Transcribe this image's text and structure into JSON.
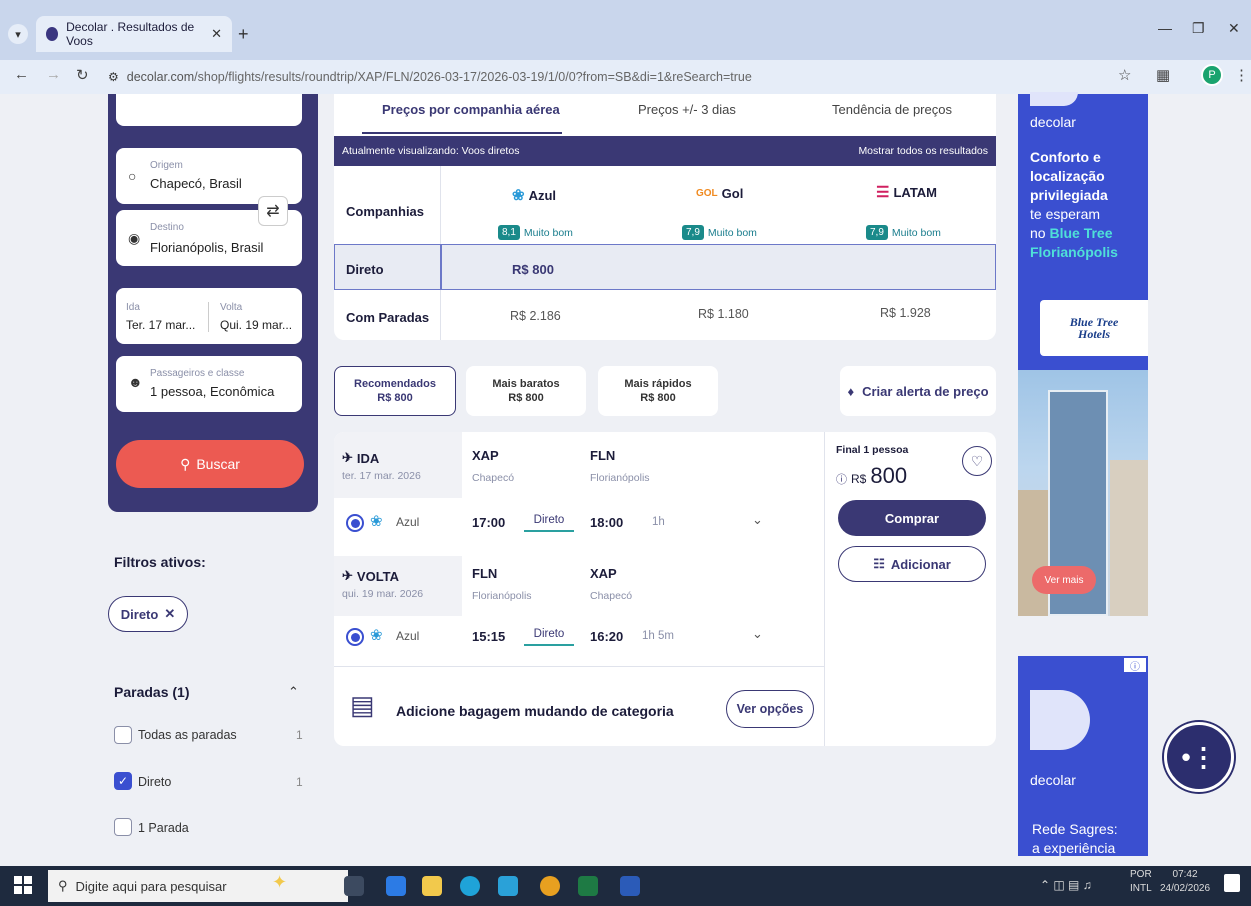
{
  "browser": {
    "tab_title": "Decolar . Resultados de Voos",
    "url_site": "decolar.com",
    "url_path": "/shop/flights/results/roundtrip/XAP/FLN/2026-03-17/2026-03-19/1/0/0?from=SB&di=1&reSearch=true",
    "profile_initial": "P"
  },
  "search": {
    "origin_label": "Origem",
    "origin_value": "Chapecó, Brasil",
    "destination_label": "Destino",
    "destination_value": "Florianópolis, Brasil",
    "ida_label": "Ida",
    "ida_value": "Ter. 17 mar...",
    "volta_label": "Volta",
    "volta_value": "Qui. 19 mar...",
    "passengers_label": "Passageiros e classe",
    "passengers_value": "1 pessoa, Econômica",
    "search_button": "Buscar"
  },
  "filters": {
    "active_title": "Filtros ativos:",
    "active_chip": "Direto",
    "stops_title": "Paradas (1)",
    "options": [
      {
        "label": "Todas as paradas",
        "count": "1",
        "checked": false
      },
      {
        "label": "Direto",
        "count": "1",
        "checked": true
      },
      {
        "label": "1 Parada",
        "count": "",
        "checked": false
      }
    ]
  },
  "matrix": {
    "tabs": [
      "Preços por companhia aérea",
      "Preços +/- 3 dias",
      "Tendência de preços"
    ],
    "viewing_text": "Atualmente visualizando: Voos diretos",
    "show_all": "Mostrar todos os resultados",
    "companies_label": "Companhias",
    "airlines": [
      {
        "name": "Azul",
        "score": "8,1",
        "rating": "Muito bom"
      },
      {
        "name": "Gol",
        "logo_text": "GOL",
        "score": "7,9",
        "rating": "Muito bom"
      },
      {
        "name": "LATAM",
        "score": "7,9",
        "rating": "Muito bom"
      }
    ],
    "direct_label": "Direto",
    "direct_prices": [
      "R$ 800",
      "",
      ""
    ],
    "stops_label": "Com Paradas",
    "stops_prices": [
      "R$ 2.186",
      "R$ 1.180",
      "R$ 1.928"
    ]
  },
  "sort": [
    {
      "label": "Recomendados",
      "price": "R$ 800"
    },
    {
      "label": "Mais baratos",
      "price": "R$ 800"
    },
    {
      "label": "Mais rápidos",
      "price": "R$ 800"
    }
  ],
  "price_alert": "Criar alerta de preço",
  "flight": {
    "outbound": {
      "title": "IDA",
      "date": "ter. 17 mar. 2026",
      "from_code": "XAP",
      "from_city": "Chapecó",
      "to_code": "FLN",
      "to_city": "Florianópolis",
      "airline": "Azul",
      "depart": "17:00",
      "type": "Direto",
      "arrive": "18:00",
      "duration": "1h"
    },
    "return": {
      "title": "VOLTA",
      "date": "qui. 19 mar. 2026",
      "from_code": "FLN",
      "from_city": "Florianópolis",
      "to_code": "XAP",
      "to_city": "Chapecó",
      "airline": "Azul",
      "depart": "15:15",
      "type": "Direto",
      "arrive": "16:20",
      "duration": "1h 5m"
    },
    "final_label": "Final 1 pessoa",
    "currency": "R$",
    "price": "800",
    "buy_button": "Comprar",
    "add_button": "Adicionar",
    "baggage_text": "Adicione bagagem mudando de categoria",
    "options_button": "Ver opções"
  },
  "ads": {
    "brand": "decolar",
    "ad1_line1": "Conforto e",
    "ad1_line2": "localização",
    "ad1_line3": "privilegiada",
    "ad1_line4": "te esperam",
    "ad1_line5_prefix": "no",
    "ad1_line5_hl": "Blue Tree",
    "ad1_line6": "Florianópolis",
    "hotel_logo_1": "Blue Tree",
    "hotel_logo_2": "Hotels",
    "see_more": "Ver mais",
    "ad2_line1": "Rede Sagres:",
    "ad2_line2": "a experiência"
  },
  "taskbar": {
    "search_placeholder": "Digite aqui para pesquisar",
    "lang1": "POR",
    "lang2": "INTL",
    "time": "07:42",
    "date": "24/02/2026"
  }
}
